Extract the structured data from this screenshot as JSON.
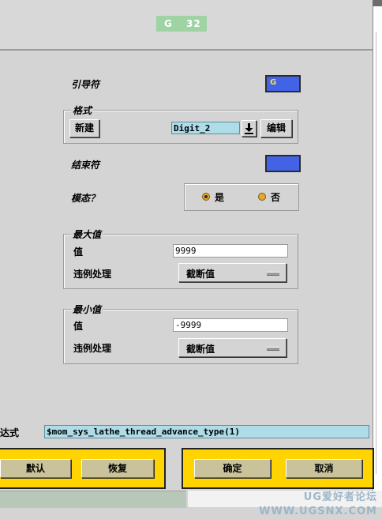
{
  "title_tag": {
    "g": "G",
    "num": "32"
  },
  "fields": {
    "leader_label": "引导符",
    "leader_value": "G",
    "format": {
      "group_label": "格式",
      "new_button": "新建",
      "format_value": "Digit_2",
      "download_icon": "download-arrow-icon",
      "edit_button": "编辑"
    },
    "trailer_label": "结束符",
    "modal_label": "模态？",
    "modal_options": {
      "yes": "是",
      "no": "否",
      "selected": "是"
    },
    "max": {
      "group_label": "最大值",
      "value_label": "值",
      "value": "9999",
      "violation_label": "违例处理",
      "violation_option": "截断值"
    },
    "min": {
      "group_label": "最小值",
      "value_label": "值",
      "value": "-9999",
      "violation_label": "违例处理",
      "violation_option": "截断值"
    },
    "expression_label": "表达式",
    "expression_value": "$mom_sys_lathe_thread_advance_type(1)"
  },
  "actions": {
    "default": "默认",
    "restore": "恢复",
    "ok": "确定",
    "cancel": "取消"
  },
  "watermark": "UG爱好者论坛 WWW.UGSNX.COM",
  "colors": {
    "swatch_blue": "#4363e6",
    "action_bar_yellow": "#ffd400",
    "title_tag_green": "#9fd3a3",
    "field_cyan": "#aedce8"
  }
}
